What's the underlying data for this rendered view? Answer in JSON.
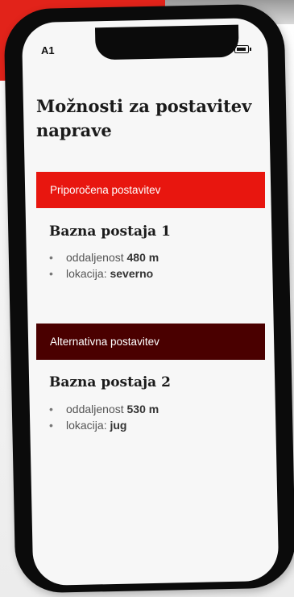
{
  "status_bar": {
    "carrier": "A1",
    "battery_icon": "battery-icon"
  },
  "page": {
    "title": "Možnosti za postavitev naprave"
  },
  "options": [
    {
      "header": "Priporočena postavitev",
      "header_color": "#e8160f",
      "station": "Bazna postaja 1",
      "distance_label": "oddaljenost",
      "distance_value": "480 m",
      "location_label": "lokacija:",
      "location_value": "severno"
    },
    {
      "header": "Alternativna postavitev",
      "header_color": "#4a0000",
      "station": "Bazna postaja 2",
      "distance_label": "oddaljenost",
      "distance_value": "530 m",
      "location_label": "lokacija:",
      "location_value": "jug"
    }
  ],
  "bullet": "•",
  "colors": {
    "accent_red": "#e2231a",
    "dark_red": "#4a0000",
    "phone_frame": "#0b0b0b",
    "screen_bg": "#f7f7f7"
  }
}
